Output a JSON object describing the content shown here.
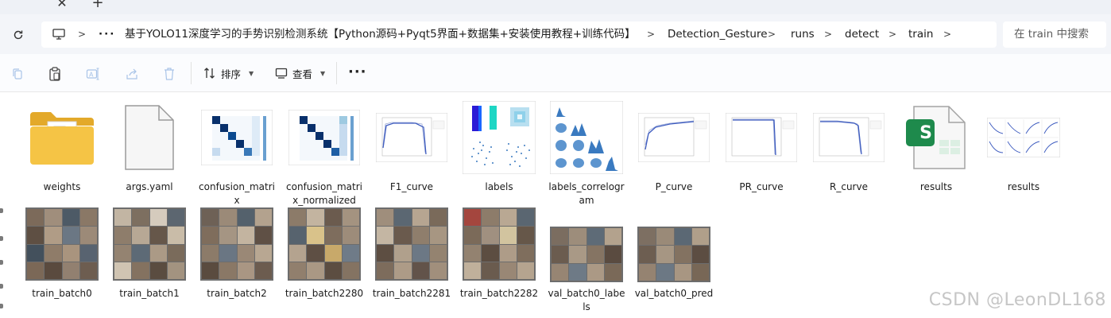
{
  "tabstrip": {
    "close_glyph": "✕",
    "new_glyph": "+"
  },
  "address": {
    "crumbs": [
      "基于YOLO11深度学习的手势识别检测系统【Python源码+Pyqt5界面+数据集+安装使用教程+训练代码】",
      "Detection_Gesture",
      "runs",
      "detect",
      "train"
    ],
    "more_glyph": "···",
    "search_placeholder": "在 train 中搜索"
  },
  "toolbar": {
    "sort_label": "排序",
    "view_label": "查看",
    "more_glyph": "···"
  },
  "files_row1": [
    {
      "label": "weights",
      "kind": "folder"
    },
    {
      "label": "args.yaml",
      "kind": "blank"
    },
    {
      "label": "confusion_matrix",
      "kind": "confusion"
    },
    {
      "label": "confusion_matrix_normalized",
      "kind": "confusion"
    },
    {
      "label": "F1_curve",
      "kind": "curve"
    },
    {
      "label": "labels",
      "kind": "labels"
    },
    {
      "label": "labels_correlogram",
      "kind": "correlogram"
    },
    {
      "label": "P_curve",
      "kind": "curve"
    },
    {
      "label": "PR_curve",
      "kind": "curve"
    },
    {
      "label": "R_curve",
      "kind": "curve"
    },
    {
      "label": "results",
      "kind": "sheet"
    },
    {
      "label": "results",
      "kind": "results"
    }
  ],
  "files_row2": [
    {
      "label": "train_batch0"
    },
    {
      "label": "train_batch1"
    },
    {
      "label": "train_batch2"
    },
    {
      "label": "train_batch2280"
    },
    {
      "label": "train_batch2281"
    },
    {
      "label": "train_batch2282"
    },
    {
      "label": "val_batch0_labels"
    },
    {
      "label": "val_batch0_pred"
    }
  ],
  "sheet_letter": "S",
  "watermark": "CSDN @LeonDL168",
  "colors": {
    "folder": "#f5c445",
    "folder_dark": "#e3a92a",
    "confusion_dark": "#08306b",
    "sheet_green": "#1e8a4c",
    "curve_blue": "#3d5bbf"
  }
}
